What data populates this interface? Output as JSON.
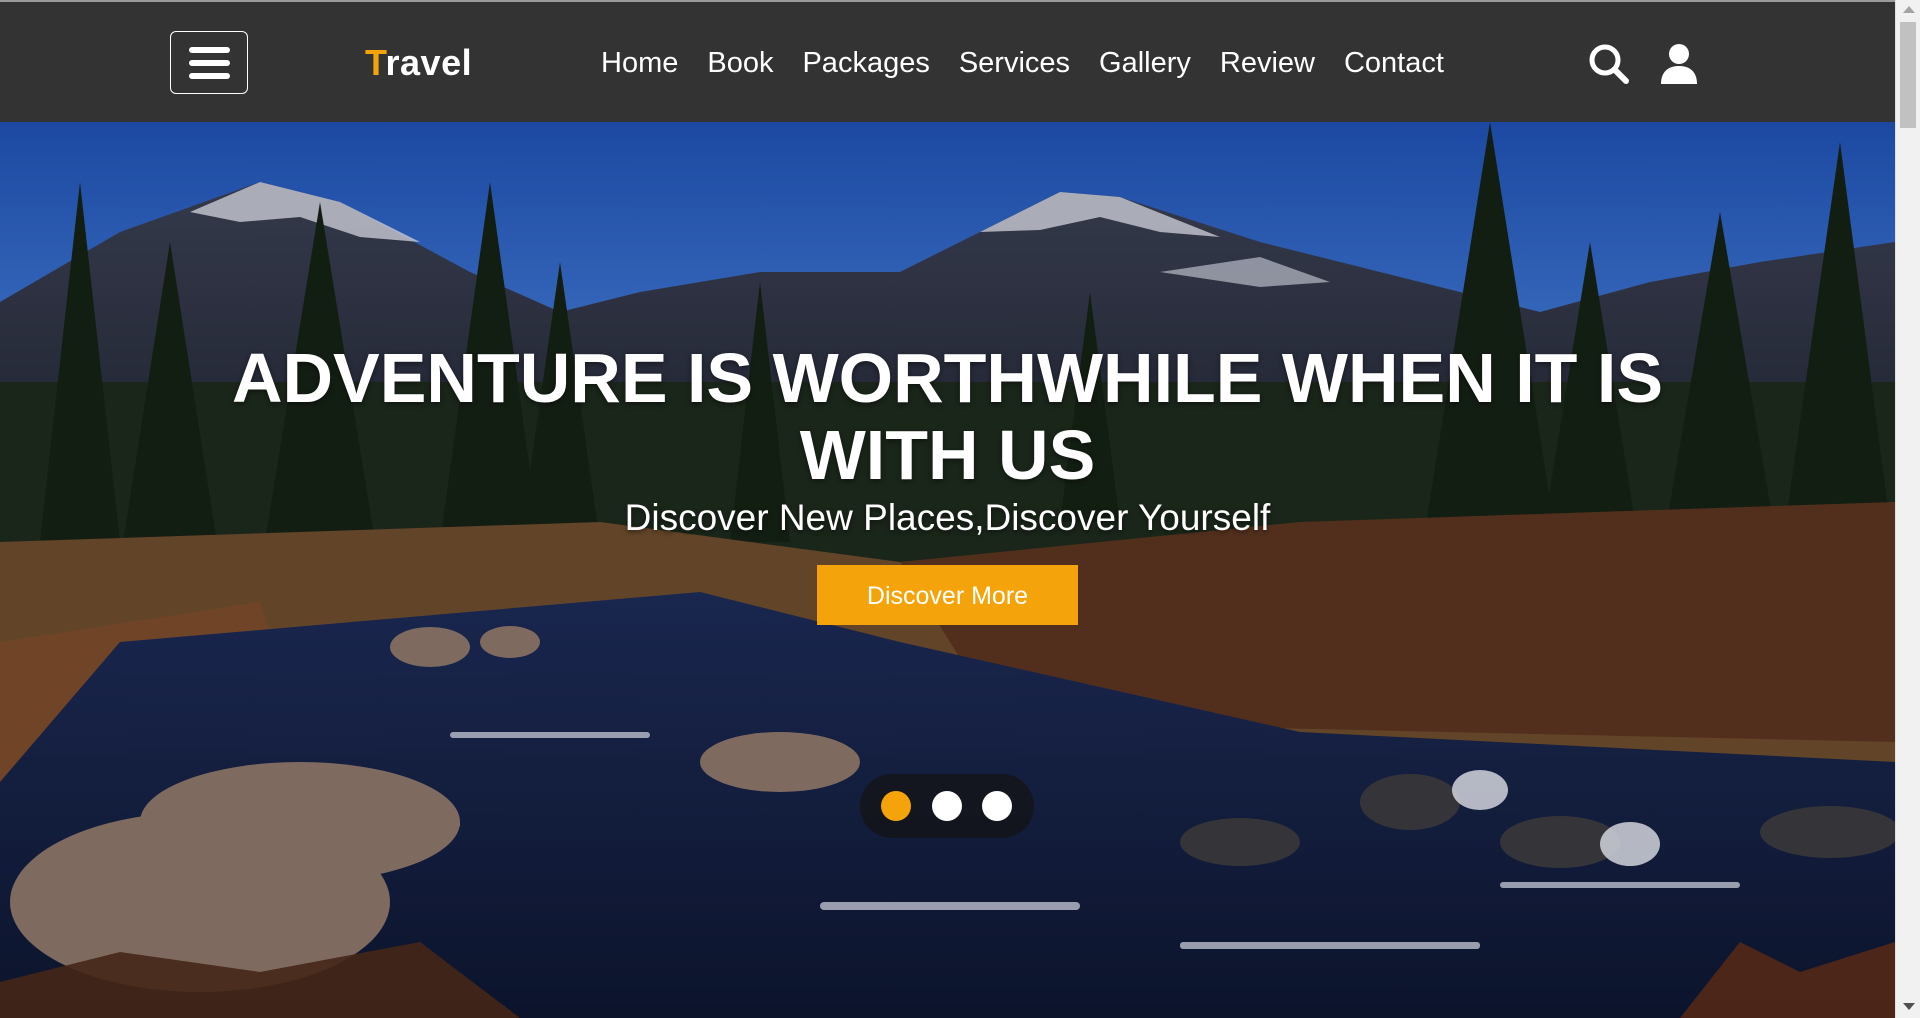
{
  "header": {
    "logo_first_letter": "T",
    "logo_rest": "ravel",
    "nav": [
      {
        "label": "Home"
      },
      {
        "label": "Book"
      },
      {
        "label": "Packages"
      },
      {
        "label": "Services"
      },
      {
        "label": "Gallery"
      },
      {
        "label": "Review"
      },
      {
        "label": "Contact"
      }
    ],
    "icons": {
      "menu": "hamburger-menu-icon",
      "search": "search-icon",
      "user": "user-icon"
    }
  },
  "hero": {
    "title": "ADVENTURE IS WORTHWHILE WHEN IT IS WITH US",
    "subtitle": "Discover New Places,Discover Yourself",
    "button_label": "Discover More",
    "slides_total": 3,
    "active_slide": 1
  },
  "colors": {
    "accent": "#f5a30a",
    "header_bg": "#333333",
    "text": "#ffffff"
  }
}
